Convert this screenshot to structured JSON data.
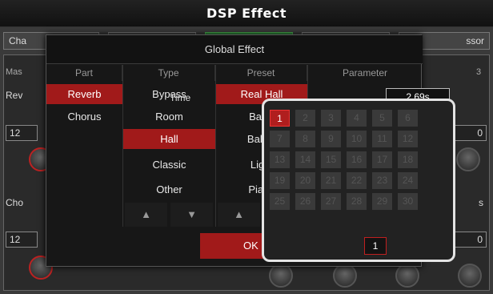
{
  "window": {
    "title": "DSP Effect"
  },
  "background": {
    "tabs": [
      "Cha",
      "",
      "",
      "",
      "ssor"
    ],
    "labels": {
      "master": "Mas",
      "rev": "Rev",
      "cho": "Cho",
      "num_right": "3"
    },
    "values": {
      "top_left": "12",
      "bottom_left": "12",
      "top_right": "0",
      "bottom_right": "0",
      "right_letter": "s"
    }
  },
  "dialog": {
    "title": "Global Effect",
    "columns": {
      "part": "Part",
      "type": "Type",
      "preset": "Preset",
      "parameter": "Parameter"
    },
    "parts": [
      "Reverb",
      "Chorus"
    ],
    "types": [
      "Bypass",
      "Room",
      "Hall",
      "Classic",
      "Other"
    ],
    "presets": [
      "Real Hall",
      "Basic",
      "Ballad",
      "Light",
      "Piano"
    ],
    "parameter": {
      "label": "Time",
      "value": "2.69s"
    },
    "arrows": {
      "up": "▲",
      "down": "▼"
    },
    "ok_label": "OK"
  },
  "grid": {
    "selected": 1,
    "numbers": [
      "1",
      "2",
      "3",
      "4",
      "5",
      "6",
      "7",
      "8",
      "9",
      "10",
      "11",
      "12",
      "13",
      "14",
      "15",
      "16",
      "17",
      "18",
      "19",
      "20",
      "21",
      "22",
      "23",
      "24",
      "25",
      "26",
      "27",
      "28",
      "29",
      "30"
    ],
    "page": "1"
  },
  "colors": {
    "accent_red": "#a11a1a",
    "highlight_green": "#2f8a3b",
    "popup_border": "#e4e4e4"
  }
}
